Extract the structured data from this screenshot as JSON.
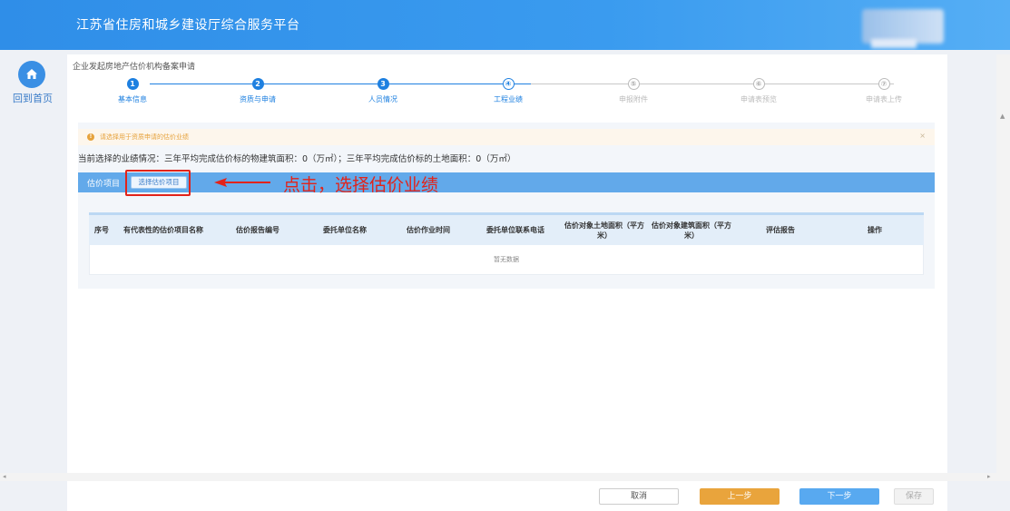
{
  "header": {
    "title": "江苏省住房和城乡建设厅综合服务平台"
  },
  "nav": {
    "home_label": "回到首页",
    "home_icon": "home-icon"
  },
  "page": {
    "heading": "企业发起房地产估价机构备案申请"
  },
  "steps": [
    {
      "num": "1",
      "label": "基本信息",
      "state": "done"
    },
    {
      "num": "2",
      "label": "资质与申请",
      "state": "done"
    },
    {
      "num": "3",
      "label": "人员情况",
      "state": "done"
    },
    {
      "num": "④",
      "label": "工程业绩",
      "state": "current"
    },
    {
      "num": "⑤",
      "label": "申报附件",
      "state": "todo"
    },
    {
      "num": "⑥",
      "label": "申请表预览",
      "state": "todo"
    },
    {
      "num": "⑦",
      "label": "申请表上传",
      "state": "todo"
    }
  ],
  "notice": {
    "text": "请选择用于资质申请的估价业绩",
    "close": "×"
  },
  "summary": "当前选择的业绩情况：三年平均完成估价标的物建筑面积：0（万㎡）；三年平均完成估价标的土地面积：0（万㎡）",
  "section": {
    "label": "估价项目",
    "select_button": "选择估价项目"
  },
  "annotation": "点击，选择估价业绩",
  "table": {
    "columns": [
      "序号",
      "有代表性的估价项目名称",
      "估价报告编号",
      "委托单位名称",
      "估价作业时间",
      "委托单位联系电话",
      "估价对象土地面积（平方米）",
      "估价对象建筑面积（平方米）",
      "评估报告",
      "操作"
    ],
    "empty_text": "暂无数据"
  },
  "footer": {
    "cancel": "取消",
    "prev": "上一步",
    "next": "下一步",
    "save": "保存"
  },
  "colors": {
    "primary": "#1e80e0",
    "warning": "#e6a23c",
    "annotation_red": "#e2231a"
  }
}
